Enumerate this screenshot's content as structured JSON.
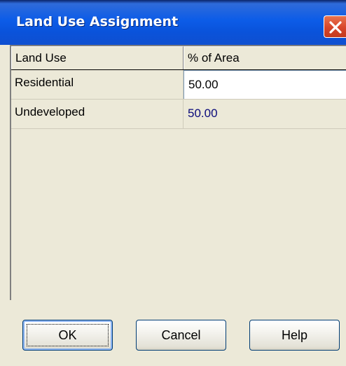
{
  "window": {
    "title": "Land Use Assignment",
    "close_icon": "close-icon"
  },
  "table": {
    "columns": [
      "Land Use",
      "% of Area"
    ],
    "rows": [
      {
        "land_use": "Residential",
        "percent": "50.00",
        "editing": true
      },
      {
        "land_use": "Undeveloped",
        "percent": "50.00",
        "editing": false
      }
    ]
  },
  "buttons": {
    "ok": "OK",
    "cancel": "Cancel",
    "help": "Help"
  },
  "colors": {
    "title_bar": "#0a53db",
    "dialog_bg": "#ece9d8",
    "readonly_value_text": "#0a0a7a",
    "close_button": "#d8452a"
  }
}
